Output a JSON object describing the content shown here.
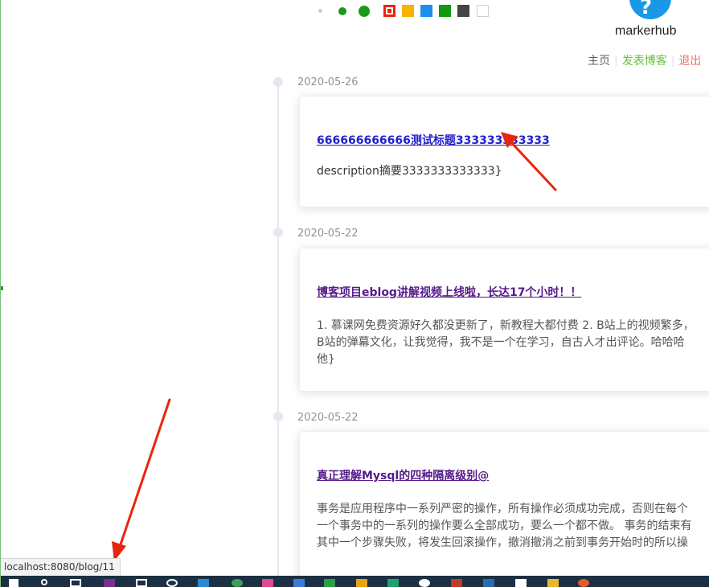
{
  "brand": {
    "name": "markerhub",
    "avatar_color": "#1a98e8"
  },
  "toolbar": {
    "tools": [
      "dot-small",
      "dot-medium",
      "dot-large",
      "color-red-selected",
      "color-yellow",
      "color-blue",
      "color-green",
      "color-dark-gray",
      "color-white"
    ],
    "colors": [
      "#e8260f",
      "#fbb100",
      "#1e8cf0",
      "#0f9a0f",
      "#444444",
      "#ffffff"
    ]
  },
  "nav": {
    "home": "主页",
    "publish": "发表博客",
    "logout": "退出"
  },
  "posts": [
    {
      "date": "2020-05-26",
      "title": "666666666666测试标题333333333333",
      "description": "description摘要3333333333333}"
    },
    {
      "date": "2020-05-22",
      "title": "博客项目eblog讲解视频上线啦，长达17个小时！！",
      "description": "1. 慕课网免费资源好久都没更新了，新教程大都付费 2. B站上的视频繁多，\nB站的弹幕文化，让我觉得，我不是一个在学习，自古人才出评论。哈哈哈\n他}"
    },
    {
      "date": "2020-05-22",
      "title": "真正理解Mysql的四种隔离级别@",
      "description": "事务是应用程序中一系列严密的操作，所有操作必须成功完成，否则在每个\n一个事务中的一系列的操作要么全部成功，要么一个都不做。 事务的结束有\n其中一个步骤失败，将发生回滚操作，撤消撤消之前到事务开始时的所以操"
    }
  ],
  "status_bar": {
    "url": "localhost:8080/blog/11"
  },
  "theme": {
    "publish_color": "#67c23a",
    "logout_color": "#f56c6c",
    "annotation_color": "#e8260f",
    "taskbar_color": "#1d2f43"
  }
}
